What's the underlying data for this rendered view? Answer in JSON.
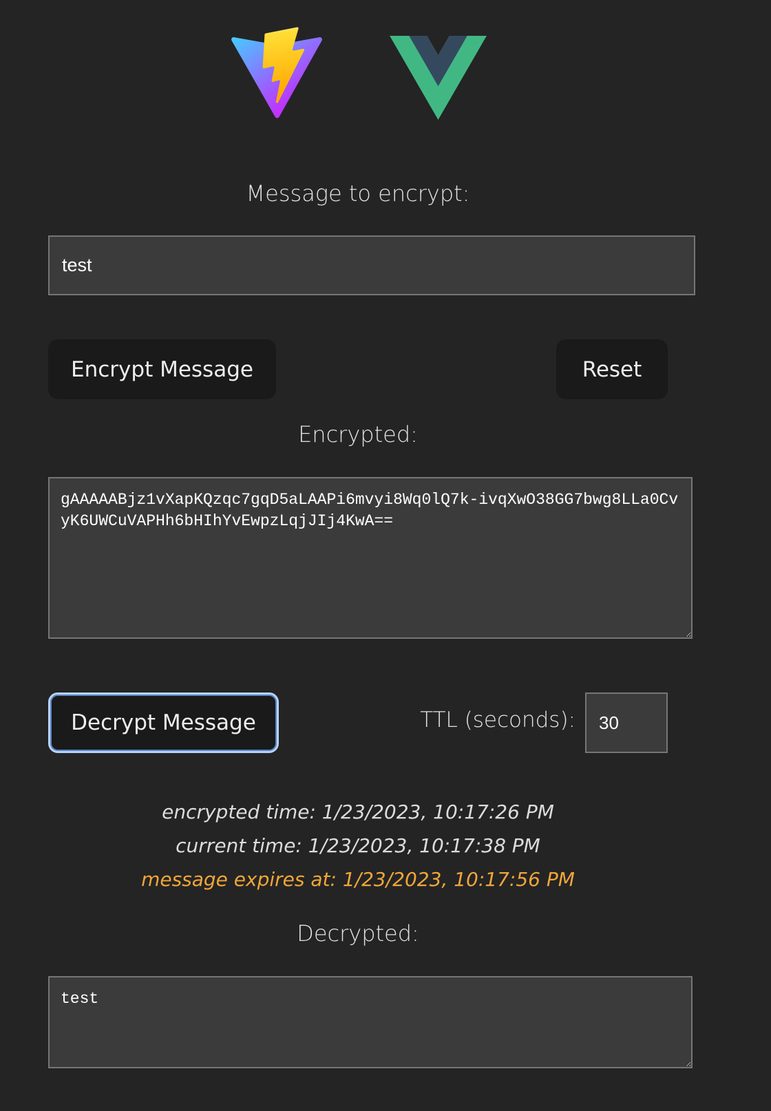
{
  "logos": {
    "vite": "vite-logo-icon",
    "vue": "vue-logo-icon"
  },
  "encrypt_section": {
    "label": "Message to encrypt:",
    "input_value": "test",
    "encrypt_button": "Encrypt Message",
    "reset_button": "Reset"
  },
  "encrypted_section": {
    "label": "Encrypted:",
    "value": "gAAAAABjz1vXapKQzqc7gqD5aLAAPi6mvyi8Wq0lQ7k-ivqXwO38GG7bwg8LLa0CvyK6UWCuVAPHh6bHIhYvEwpzLqjJIj4KwA=="
  },
  "decrypt_section": {
    "decrypt_button": "Decrypt Message",
    "ttl_label": "TTL (seconds):",
    "ttl_value": "30"
  },
  "times": {
    "encrypted_time": "encrypted time: 1/23/2023, 10:17:26 PM",
    "current_time": "current time: 1/23/2023, 10:17:38 PM",
    "expires_at": "message expires at: 1/23/2023, 10:17:56 PM"
  },
  "decrypted_section": {
    "label": "Decrypted:",
    "value": "test"
  },
  "colors": {
    "background": "#242424",
    "expires_text": "#f0a63a",
    "info_text": "#dcdcdc",
    "vue_green": "#41b883",
    "vue_dark": "#35495e"
  }
}
